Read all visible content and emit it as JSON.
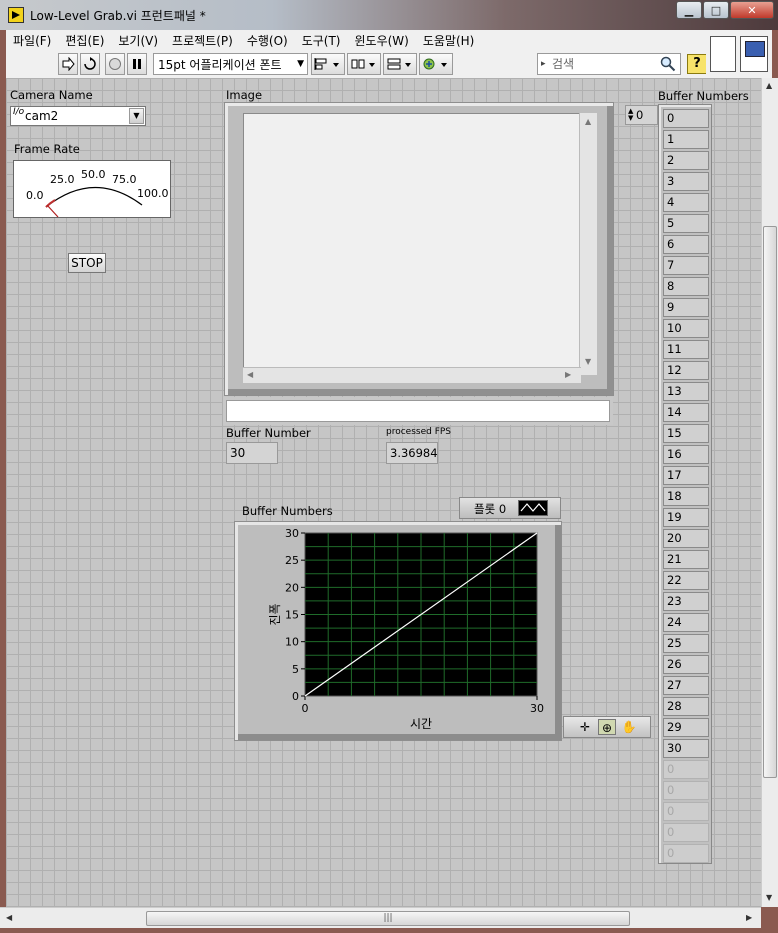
{
  "window": {
    "title": "Low-Level Grab.vi 프런트패널 *",
    "min_glyph": "▁",
    "max_glyph": "□",
    "close_glyph": "✕"
  },
  "menu": {
    "items": [
      "파일(F)",
      "편집(E)",
      "보기(V)",
      "프로젝트(P)",
      "수행(O)",
      "도구(T)",
      "윈도우(W)",
      "도움말(H)"
    ]
  },
  "toolbar": {
    "font_label": "15pt 어플리케이션 폰트",
    "search_placeholder": "검색",
    "help_glyph": "?",
    "icons": [
      "run-arrow-icon",
      "run-continuously-icon",
      "abort-icon",
      "pause-icon",
      "align-icon",
      "distribute-icon",
      "resize-icon",
      "reorder-icon"
    ]
  },
  "panel": {
    "camera": {
      "label": "Camera Name",
      "value": "cam2",
      "io_glyph": "I/o"
    },
    "frame_rate": {
      "label": "Frame Rate",
      "scale": [
        "0.0",
        "25.0",
        "50.0",
        "75.0",
        "100.0"
      ],
      "value": 0.0
    },
    "stop_label": "STOP",
    "image": {
      "label": "Image"
    },
    "buffer_number": {
      "label": "Buffer Number",
      "value": "30"
    },
    "fps": {
      "label": "processed FPS",
      "value": "3.36984"
    },
    "buffer_numbers": {
      "label": "Buffer Numbers",
      "index": "0",
      "values": [
        "0",
        "1",
        "2",
        "3",
        "4",
        "5",
        "6",
        "7",
        "8",
        "9",
        "10",
        "11",
        "12",
        "13",
        "14",
        "15",
        "16",
        "17",
        "18",
        "19",
        "20",
        "21",
        "22",
        "23",
        "24",
        "25",
        "26",
        "27",
        "28",
        "29",
        "30"
      ],
      "empty_values": [
        "0",
        "0",
        "0",
        "0",
        "0"
      ]
    },
    "legend": {
      "plot_label": "플롯 0"
    }
  },
  "chart_data": {
    "type": "line",
    "title": "Buffer Numbers",
    "xlabel": "시간",
    "ylabel": "진폭",
    "xlim": [
      0,
      30
    ],
    "ylim": [
      0,
      30
    ],
    "x_ticks": [
      "0",
      "30"
    ],
    "y_ticks": [
      "0",
      "5",
      "10",
      "15",
      "20",
      "25",
      "30"
    ],
    "grid": true,
    "background": "#000000",
    "grid_color": "#1f6b2a",
    "line_color": "#ffffff",
    "series": [
      {
        "x": [
          0,
          30
        ],
        "y": [
          0,
          30
        ]
      }
    ]
  }
}
